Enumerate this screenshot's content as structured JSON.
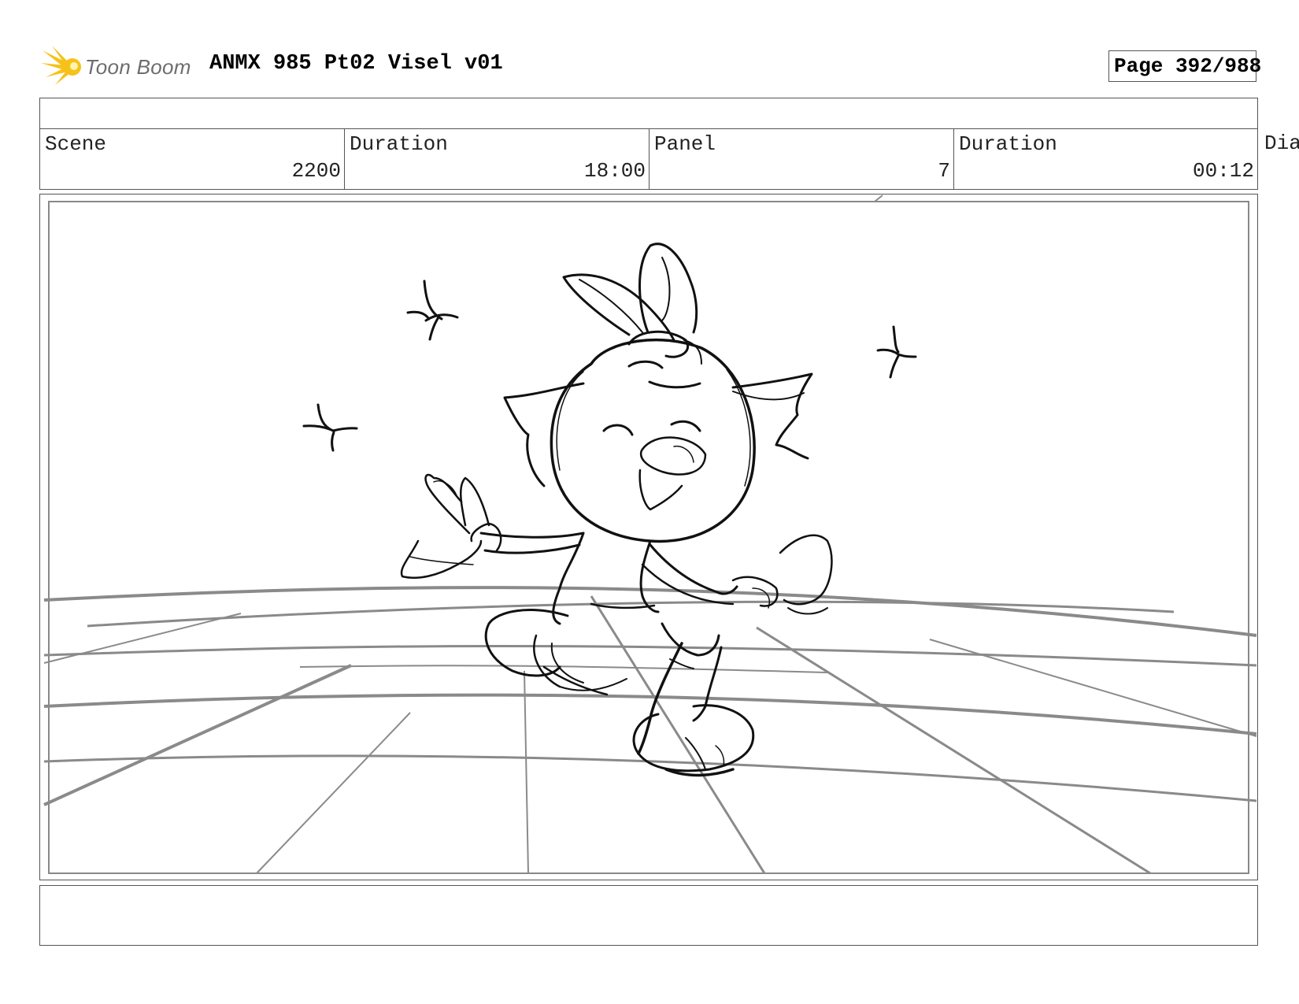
{
  "header": {
    "logo_text": "Toon Boom",
    "title": "ANMX 985 Pt02 Visel v01",
    "page": "Page 392/988"
  },
  "info": {
    "scene_label": "Scene",
    "scene_value": "2200",
    "scene_duration_label": "Duration",
    "scene_duration_value": "18:00",
    "panel_label": "Panel",
    "panel_value": "7",
    "panel_duration_label": "Duration",
    "panel_duration_value": "00:12",
    "dialog_label": "Dia"
  },
  "colors": {
    "logo_yellow": "#f6c21a",
    "sketch_line": "#111111",
    "floor_line": "#8a8a8a"
  }
}
